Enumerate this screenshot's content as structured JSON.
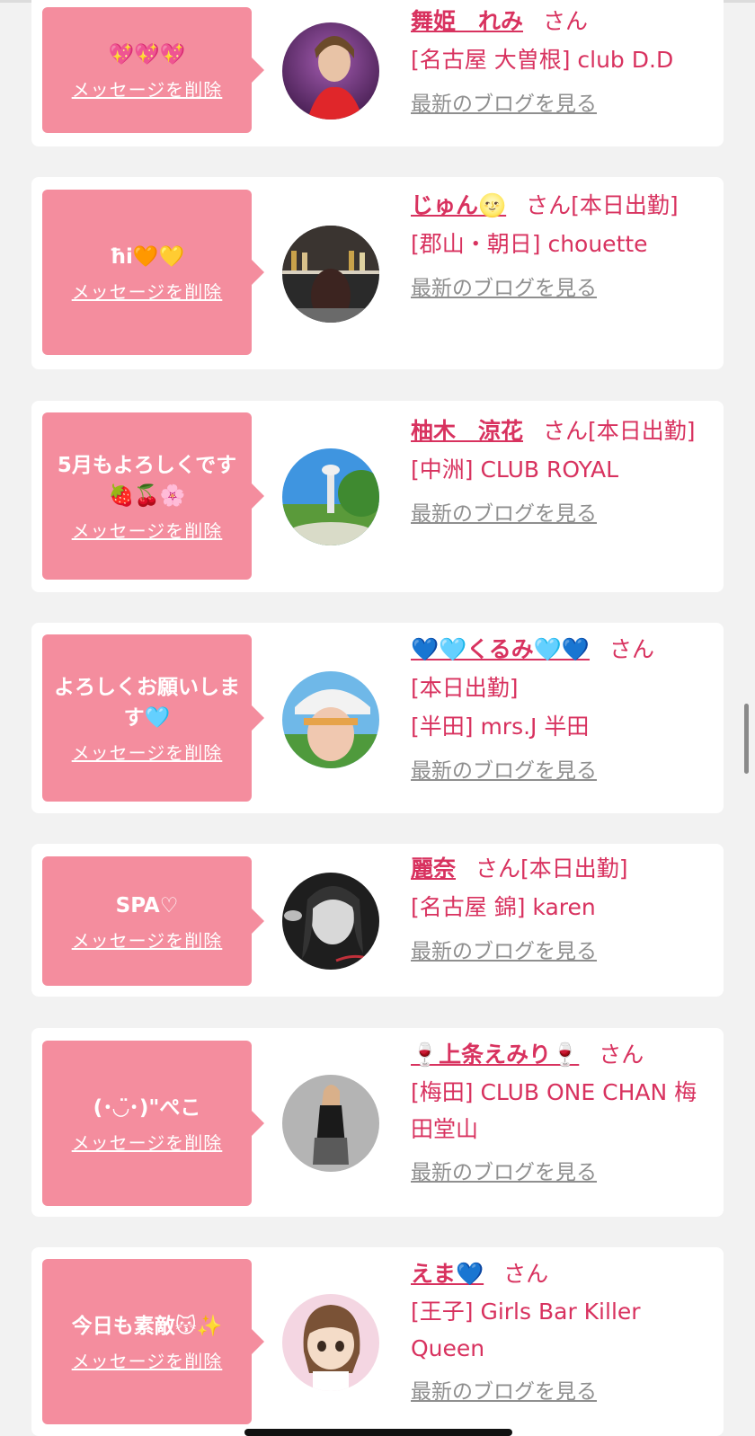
{
  "delete_label": "メッセージを削除",
  "blog_label": "最新のブログを見る",
  "san_label": "さん",
  "colors": {
    "bubble": "#f48d9e",
    "accent": "#d8325f",
    "link_gray": "#8f8f8f"
  },
  "entries": [
    {
      "message": "💖💖💖",
      "name": "舞姫　れみ",
      "status": "",
      "shop": "[名古屋 大曽根] club D.D"
    },
    {
      "message": "ħi🧡💛",
      "name": "じゅん🌝",
      "status": "[本日出勤]",
      "shop": "[郡山・朝日] chouette"
    },
    {
      "message": "5月もよろしくです🍓🍒🌸",
      "name": "柚木　涼花",
      "status": "[本日出勤]",
      "shop": "[中洲] CLUB ROYAL"
    },
    {
      "message": "よろしくお願いします🩵",
      "name": "💙🩵くるみ🩵💙",
      "status": "[本日出勤]",
      "shop": "[半田] mrs.J 半田"
    },
    {
      "message": "SPA♡",
      "name": "麗奈",
      "status": "[本日出勤]",
      "shop": "[名古屋 錦] karen"
    },
    {
      "message": "(･◡̈･)\"ぺこ",
      "name": "🍷上条えみり🍷",
      "status": "",
      "shop": "[梅田] CLUB ONE CHAN 梅田堂山"
    },
    {
      "message": "今日も素敵😽✨",
      "name": "えま💙",
      "status": "",
      "shop": "[王子] Girls Bar Killer Queen"
    }
  ]
}
